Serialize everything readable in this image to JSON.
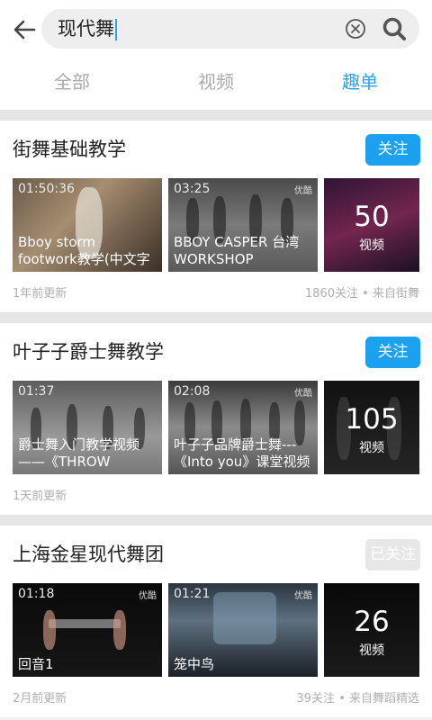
{
  "search": {
    "value": "现代舞"
  },
  "tabs": [
    {
      "label": "全部",
      "active": false
    },
    {
      "label": "视频",
      "active": false
    },
    {
      "label": "趣单",
      "active": true
    }
  ],
  "colors": {
    "accent": "#1ba1f0",
    "followed": "#e7e7e7"
  },
  "cards": [
    {
      "title": "街舞基础教学",
      "follow_label": "关注",
      "videos": [
        {
          "duration": "01:50:36",
          "caption": "Bboy storm footwork教学(中文字",
          "source": ""
        },
        {
          "duration": "03:25",
          "caption": "BBOY CASPER 台湾 WORKSHOP",
          "source": "优酷"
        }
      ],
      "more_count": "50",
      "more_label": "视频",
      "updated": "1年前更新",
      "meta": "1860关注 • 来自街舞"
    },
    {
      "title": "叶子子爵士舞教学",
      "follow_label": "关注",
      "videos": [
        {
          "duration": "01:37",
          "caption": "爵士舞入门教学视频——《THROW",
          "source": ""
        },
        {
          "duration": "02:08",
          "caption": "叶子子品牌爵士舞---《Into you》课堂视频",
          "source": "优酷"
        }
      ],
      "more_count": "105",
      "more_label": "视频",
      "updated": "1天前更新",
      "meta": ""
    },
    {
      "title": "上海金星现代舞团",
      "follow_label": "已关注",
      "videos": [
        {
          "duration": "01:18",
          "caption": "回音1",
          "source": "优酷"
        },
        {
          "duration": "01:21",
          "caption": "笼中鸟",
          "source": "优酷"
        }
      ],
      "more_count": "26",
      "more_label": "视频",
      "updated": "2月前更新",
      "meta": "39关注 • 来自舞蹈精选"
    }
  ]
}
